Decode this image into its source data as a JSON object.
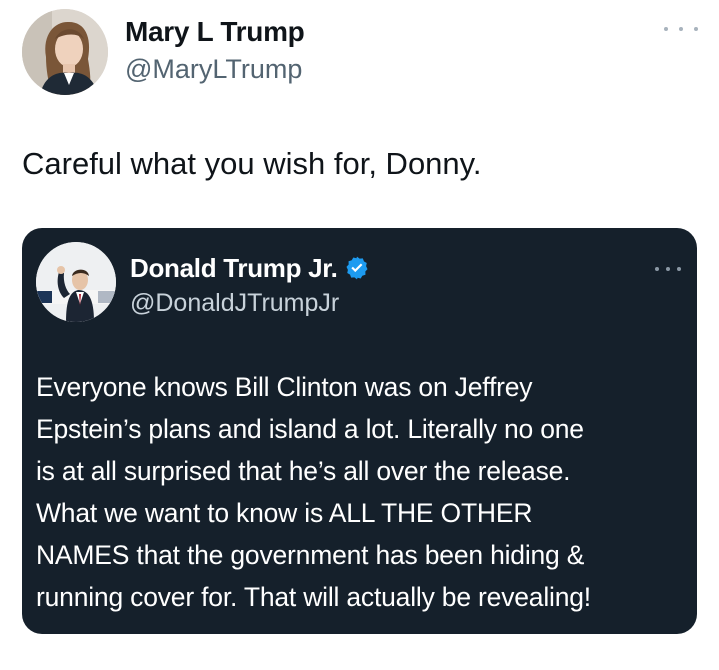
{
  "tweet": {
    "author": {
      "display_name": "Mary L Trump",
      "handle": "@MaryLTrump",
      "avatar_icon": "profile-photo"
    },
    "text": "Careful what you wish for, Donny.",
    "more_icon": "more-options-icon"
  },
  "quoted_tweet": {
    "author": {
      "display_name": "Donald Trump Jr.",
      "handle": "@DonaldJTrumpJr",
      "verified": true,
      "verified_color": "#1d9bf0",
      "avatar_icon": "profile-photo"
    },
    "text_lines": [
      "Everyone knows Bill Clinton was on Jeffrey",
      "Epstein’s plans and island a lot. Literally no one",
      "is at all surprised that he’s all over the release.",
      "What we want to know is ALL THE OTHER",
      "NAMES that the government has been hiding &",
      "running cover for. That will actually be revealing!"
    ],
    "background_color": "#15202b",
    "more_icon": "more-options-icon"
  }
}
